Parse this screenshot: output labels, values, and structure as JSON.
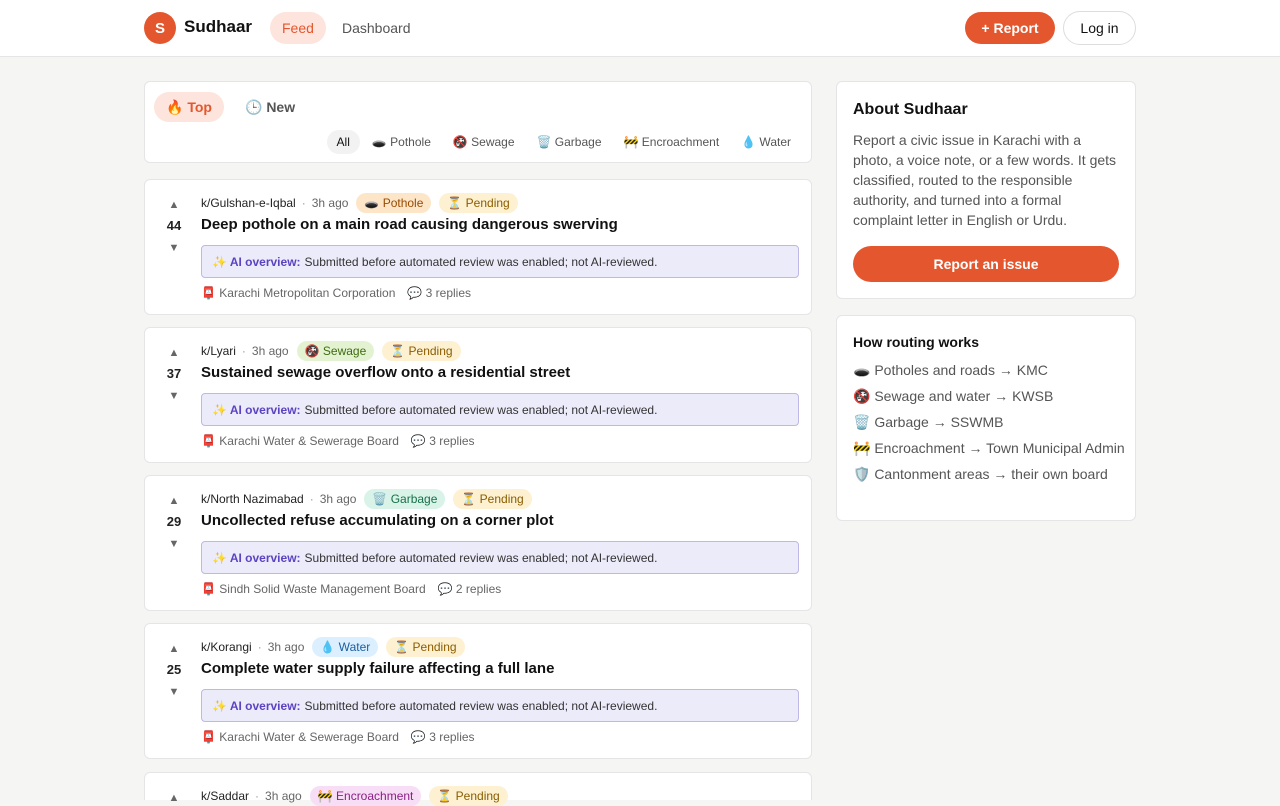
{
  "header": {
    "logo_letter": "S",
    "brand": "Sudhaar",
    "nav_feed": "Feed",
    "nav_dashboard": "Dashboard",
    "report_button": "+ Report",
    "login_button": "Log in"
  },
  "filters": {
    "sort_top": "🔥 Top",
    "sort_new": "🕒 New",
    "categories": [
      "All",
      "🕳️ Pothole",
      "🚱 Sewage",
      "🗑️ Garbage",
      "🚧 Encroachment",
      "💧 Water"
    ]
  },
  "posts": [
    {
      "score": "44",
      "sub": "k/Gulshan-e-Iqbal",
      "time": "3h ago",
      "category": "🕳️ Pothole",
      "status": "⏳ Pending",
      "title": "Deep pothole on a main road causing dangerous swerving",
      "ai_label": "✨ AI overview:",
      "ai_text": "Submitted before automated review was enabled; not AI-reviewed.",
      "authority": "📮 Karachi Metropolitan Corporation",
      "replies": "💬 3 replies"
    },
    {
      "score": "37",
      "sub": "k/Lyari",
      "time": "3h ago",
      "category": "🚱 Sewage",
      "status": "⏳ Pending",
      "title": "Sustained sewage overflow onto a residential street",
      "ai_label": "✨ AI overview:",
      "ai_text": "Submitted before automated review was enabled; not AI-reviewed.",
      "authority": "📮 Karachi Water & Sewerage Board",
      "replies": "💬 3 replies"
    },
    {
      "score": "29",
      "sub": "k/North Nazimabad",
      "time": "3h ago",
      "category": "🗑️ Garbage",
      "status": "⏳ Pending",
      "title": "Uncollected refuse accumulating on a corner plot",
      "ai_label": "✨ AI overview:",
      "ai_text": "Submitted before automated review was enabled; not AI-reviewed.",
      "authority": "📮 Sindh Solid Waste Management Board",
      "replies": "💬 2 replies"
    },
    {
      "score": "25",
      "sub": "k/Korangi",
      "time": "3h ago",
      "category": "💧 Water",
      "status": "⏳ Pending",
      "title": "Complete water supply failure affecting a full lane",
      "ai_label": "✨ AI overview:",
      "ai_text": "Submitted before automated review was enabled; not AI-reviewed.",
      "authority": "📮 Karachi Water & Sewerage Board",
      "replies": "💬 3 replies"
    },
    {
      "sub": "k/Saddar",
      "time": "3h ago",
      "category": "🚧 Encroachment",
      "status": "⏳ Pending"
    }
  ],
  "about": {
    "title": "About Sudhaar",
    "text": "Report a civic issue in Karachi with a photo, a voice note, or a few words. It gets classified, routed to the responsible authority, and turned into a formal complaint letter in English or Urdu.",
    "cta": "Report an issue"
  },
  "routing": {
    "title": "How routing works",
    "items": [
      "🕳️ Potholes and roads → KMC",
      "🚱 Sewage and water → KWSB",
      "🗑️ Garbage → SSWMB",
      "🚧 Encroachment → Town Municipal Admin",
      "🛡️ Cantonment areas → their own board"
    ]
  },
  "colors": {
    "accent": "#e4572e",
    "ai_border": "#bdb8e6",
    "ai_bg": "#ecebfa"
  }
}
